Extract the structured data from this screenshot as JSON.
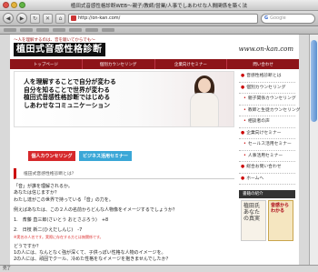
{
  "window": {
    "title": "植田式音感性格診断WEB〜親子/教師/営業/人事でしあわせな人間関係を築く法"
  },
  "toolbar": {
    "url": "http://on-kan.com/",
    "search_placeholder": "Google"
  },
  "header": {
    "tagline": "〜人を理解するのは、音を聴いてからでも〜",
    "logo_text": "植田式音感性格診断",
    "site_url": "www.on-kan.com"
  },
  "nav": [
    "トップページ",
    "個別カウンセリング",
    "企業向けセミナー",
    "問い合わせ"
  ],
  "hero": {
    "lines": [
      "人を理解することで自分が変わる",
      "自分を知ることで世界が変わる",
      "植田式音感性格診断ではじめる",
      "しあわせなコミュニケーション"
    ],
    "button_counseling": "個人カウンセリング",
    "button_seminar": "ビジネス活用セミナー"
  },
  "content": {
    "breadcrumb": "植田式音感性格診断とは？",
    "paragraphs": [
      "「音」が誰を理解されるか。",
      "あなたは信じますか？",
      "わたし達がこの世界で持っている「音」の力を。",
      "",
      "例えばあなたは、この２人の名前からどんな人物像をイメージするでしょうか？",
      "",
      "1.　斎藤 直三郎(さいとう おとさぶろう)　+8",
      "",
      "2.　日枝 新二(ひえだしんじ)　-7"
    ],
    "note": "※実名の人名です。実際に存在する方とは無関係です。",
    "paragraphs2": [
      "どうですか？",
      "1の人には、なんとなく強が深くて、子供っぽい性格な人物のイメージを。",
      "2の人には、頑固でクール、冷めた性格をなイメージを抱きませんでしたか？"
    ]
  },
  "sidebar": {
    "items": [
      {
        "label": "音感性格診断とは",
        "sub": false
      },
      {
        "label": "個別カウンセリング",
        "sub": false
      },
      {
        "label": "親子関係カウンセリング",
        "sub": true
      },
      {
        "label": "教師と生徒カウンセリング",
        "sub": true
      },
      {
        "label": "相談者の声",
        "sub": true
      },
      {
        "label": "企業向けセミナー",
        "sub": false
      },
      {
        "label": "セールス活用セミナー",
        "sub": true
      },
      {
        "label": "人事活用セミナー",
        "sub": true
      },
      {
        "label": "総合お問い合わせ",
        "sub": false
      },
      {
        "label": "ホームへ",
        "sub": false
      }
    ],
    "book_heading": "書籍の紹介",
    "book_a": "植田氏 あなたの真実",
    "book_b": "音感からわかる"
  },
  "status": {
    "text": "完了"
  }
}
